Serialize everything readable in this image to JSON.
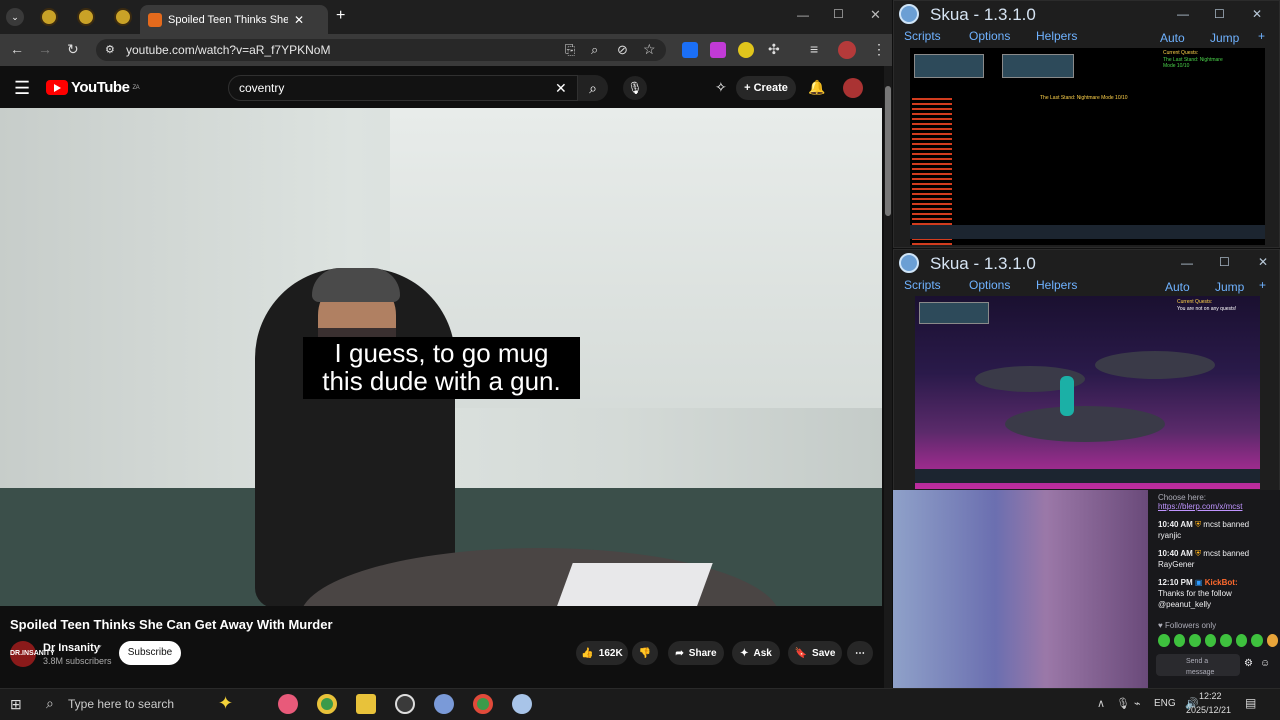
{
  "browser": {
    "tab_title": "Spoiled Teen Thinks She Ca",
    "url": "youtube.com/watch?v=aR_f7YPKNoM"
  },
  "youtube": {
    "logo_text": "YouTube",
    "country_code": "ZA",
    "search_value": "coventry",
    "create_label": "Create",
    "caption_line1": "I guess, to go mug",
    "caption_line2": "this dude with a gun.",
    "video_title": "Spoiled Teen Thinks She Can Get Away With Murder",
    "channel_name": "Dr Insanity",
    "channel_avatar_text": "DR.INSANITY",
    "subscribers": "3.8M subscribers",
    "subscribe_label": "Subscribe",
    "likes": "162K",
    "share_label": "Share",
    "ask_label": "Ask",
    "save_label": "Save"
  },
  "skua_top": {
    "title": "Skua - 1.3.1.0",
    "menu": [
      "Scripts",
      "Options",
      "Helpers"
    ],
    "right_menu": [
      "Auto",
      "Jump",
      "+"
    ],
    "quest_heading": "Current Quests:",
    "quest_text": "The Last Stand: Nightmare Mode 10/10",
    "map_text": "The Last Stand: Nightmare Mode 10/10"
  },
  "skua_bottom": {
    "title": "Skua - 1.3.1.0",
    "menu": [
      "Scripts",
      "Options",
      "Helpers"
    ],
    "right_menu": [
      "Auto",
      "Jump",
      "+"
    ],
    "quest_heading": "Current Quests:",
    "quest_text": "You are not on any quests!"
  },
  "chat": {
    "line0": "Choose here:",
    "link": "https://blerp.com/x/mcst",
    "msg1_time": "10:40 AM",
    "msg1_text": "mcst banned",
    "msg1_user": "ryanjic",
    "msg2_time": "10:40 AM",
    "msg2_text": "mcst banned",
    "msg2_user": "RayGener",
    "msg3_time": "12:10 PM",
    "msg3_bot": "KickBot:",
    "msg3_text": "Thanks for the follow",
    "msg3_user": "@peanut_kelly",
    "followers_only": "Followers only",
    "send_placeholder": "Send a message"
  },
  "taskbar": {
    "search_placeholder": "Type here to search",
    "language": "ENG",
    "time": "12:22",
    "date": "2025/12/21"
  }
}
